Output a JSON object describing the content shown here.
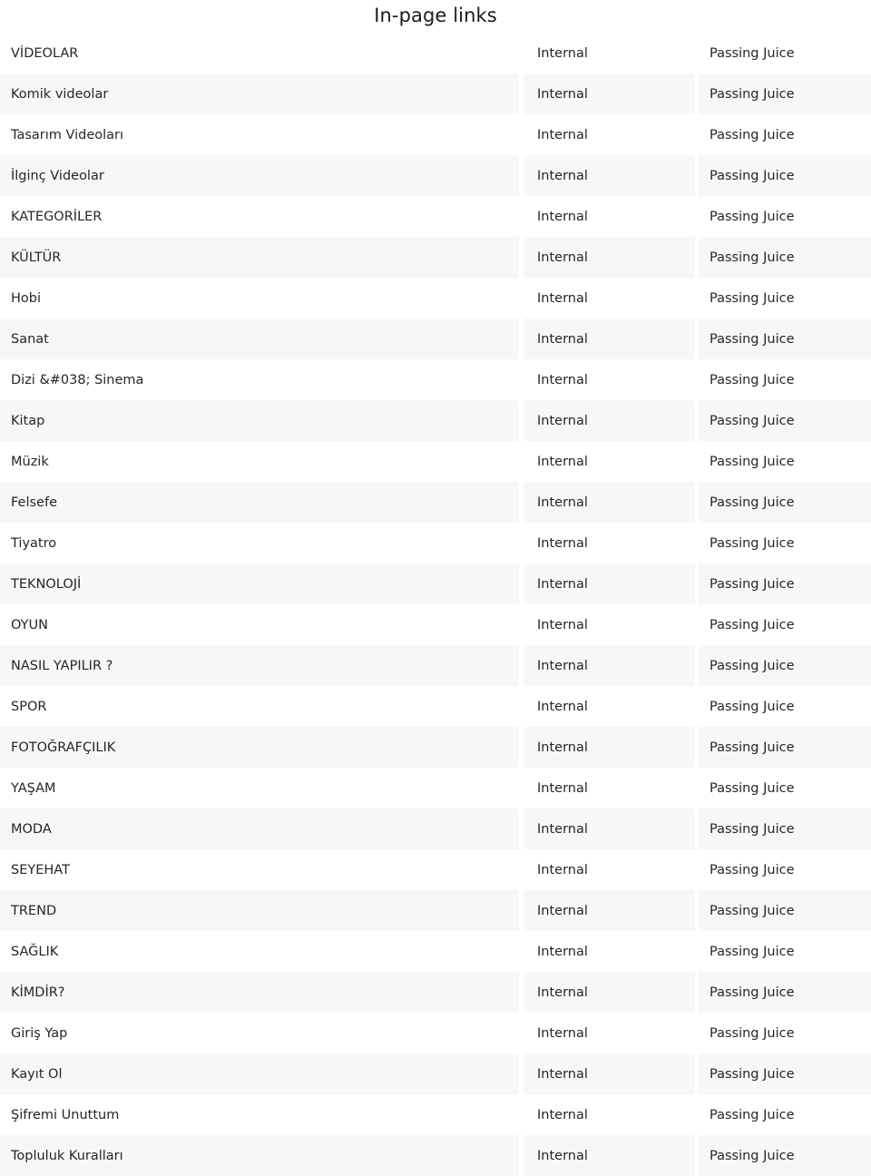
{
  "header": {
    "title": "In-page links"
  },
  "table": {
    "columns": [
      "anchor",
      "type",
      "juice"
    ],
    "type_label": "Internal",
    "juice_label": "Passing Juice",
    "rows": [
      {
        "anchor": "VİDEOLAR",
        "type": "Internal",
        "juice": "Passing Juice"
      },
      {
        "anchor": "Komik videolar",
        "type": "Internal",
        "juice": "Passing Juice"
      },
      {
        "anchor": "Tasarım Videoları",
        "type": "Internal",
        "juice": "Passing Juice"
      },
      {
        "anchor": "İlginç Videolar",
        "type": "Internal",
        "juice": "Passing Juice"
      },
      {
        "anchor": "KATEGORİLER",
        "type": "Internal",
        "juice": "Passing Juice"
      },
      {
        "anchor": "KÜLTÜR",
        "type": "Internal",
        "juice": "Passing Juice"
      },
      {
        "anchor": "Hobi",
        "type": "Internal",
        "juice": "Passing Juice"
      },
      {
        "anchor": "Sanat",
        "type": "Internal",
        "juice": "Passing Juice"
      },
      {
        "anchor": "Dizi &#038; Sinema",
        "type": "Internal",
        "juice": "Passing Juice"
      },
      {
        "anchor": "Kitap",
        "type": "Internal",
        "juice": "Passing Juice"
      },
      {
        "anchor": "Müzik",
        "type": "Internal",
        "juice": "Passing Juice"
      },
      {
        "anchor": "Felsefe",
        "type": "Internal",
        "juice": "Passing Juice"
      },
      {
        "anchor": "Tiyatro",
        "type": "Internal",
        "juice": "Passing Juice"
      },
      {
        "anchor": "TEKNOLOJİ",
        "type": "Internal",
        "juice": "Passing Juice"
      },
      {
        "anchor": "OYUN",
        "type": "Internal",
        "juice": "Passing Juice"
      },
      {
        "anchor": "NASIL YAPILIR ?",
        "type": "Internal",
        "juice": "Passing Juice"
      },
      {
        "anchor": "SPOR",
        "type": "Internal",
        "juice": "Passing Juice"
      },
      {
        "anchor": "FOTOĞRAFÇILIK",
        "type": "Internal",
        "juice": "Passing Juice"
      },
      {
        "anchor": "YAŞAM",
        "type": "Internal",
        "juice": "Passing Juice"
      },
      {
        "anchor": "MODA",
        "type": "Internal",
        "juice": "Passing Juice"
      },
      {
        "anchor": "SEYEHAT",
        "type": "Internal",
        "juice": "Passing Juice"
      },
      {
        "anchor": "TREND",
        "type": "Internal",
        "juice": "Passing Juice"
      },
      {
        "anchor": "SAĞLIK",
        "type": "Internal",
        "juice": "Passing Juice"
      },
      {
        "anchor": "KİMDİR?",
        "type": "Internal",
        "juice": "Passing Juice"
      },
      {
        "anchor": "Giriş Yap",
        "type": "Internal",
        "juice": "Passing Juice"
      },
      {
        "anchor": "Kayıt Ol",
        "type": "Internal",
        "juice": "Passing Juice"
      },
      {
        "anchor": "Şifremi Unuttum",
        "type": "Internal",
        "juice": "Passing Juice"
      },
      {
        "anchor": "Topluluk Kuralları",
        "type": "Internal",
        "juice": "Passing Juice"
      }
    ]
  },
  "colors": {
    "page_background": "#ffffff",
    "row_stripe": "#f7f7f7",
    "text": "#262626",
    "title_text": "#1a1a1a"
  }
}
